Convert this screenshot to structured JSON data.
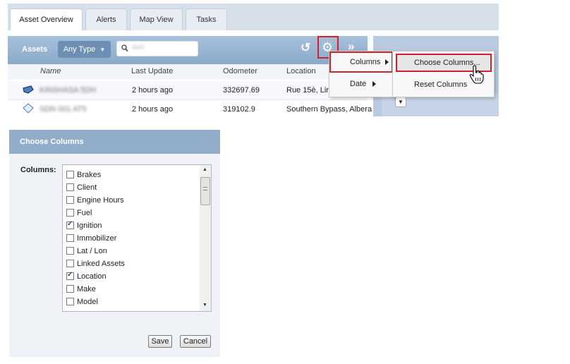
{
  "tabs": [
    {
      "label": "Asset Overview",
      "active": true
    },
    {
      "label": "Alerts",
      "active": false
    },
    {
      "label": "Map View",
      "active": false
    },
    {
      "label": "Tasks",
      "active": false
    }
  ],
  "assets_toolbar": {
    "title": "Assets",
    "type_filter": "Any Type",
    "search_value": "asn"
  },
  "table": {
    "columns": [
      "Name",
      "Last Update",
      "Odometer",
      "Location"
    ],
    "rows": [
      {
        "name": "KINSHASA 5DH",
        "last_update": "2 hours ago",
        "odometer": "332697.69",
        "location": "Rue 15è, Lim"
      },
      {
        "name": "SDN 001 AT5",
        "last_update": "2 hours ago",
        "odometer": "319102.9",
        "location": "Southern Bypass, Albera"
      }
    ]
  },
  "menu": {
    "items": [
      {
        "label": "Columns"
      },
      {
        "label": "Date"
      }
    ],
    "submenu": [
      {
        "label": "Choose Columns..."
      },
      {
        "label": "Reset Columns"
      }
    ]
  },
  "dialog": {
    "title": "Choose Columns",
    "columns_label": "Columns:",
    "options": [
      {
        "label": "Brakes",
        "checked": false
      },
      {
        "label": "Client",
        "checked": false
      },
      {
        "label": "Engine Hours",
        "checked": false
      },
      {
        "label": "Fuel",
        "checked": false
      },
      {
        "label": "Ignition",
        "checked": true
      },
      {
        "label": "Immobilizer",
        "checked": false
      },
      {
        "label": "Lat / Lon",
        "checked": false
      },
      {
        "label": "Linked Assets",
        "checked": false
      },
      {
        "label": "Location",
        "checked": true
      },
      {
        "label": "Make",
        "checked": false
      },
      {
        "label": "Model",
        "checked": false
      }
    ],
    "save_label": "Save",
    "cancel_label": "Cancel"
  },
  "colors": {
    "toolbar": "#8aa9c9",
    "highlight": "#d0232a",
    "dialog_header": "#91adca"
  }
}
